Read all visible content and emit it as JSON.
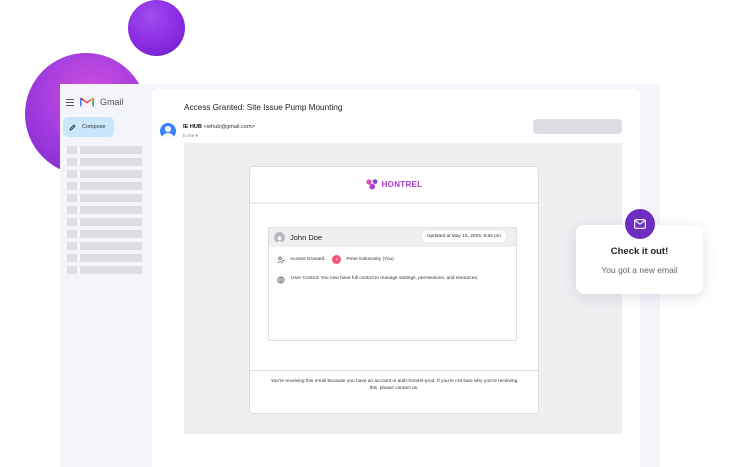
{
  "gmail": {
    "app_label": "Gmail",
    "compose_label": "Compose"
  },
  "email": {
    "subject": "Access Granted: Site Issue Pump Mounting",
    "sender_name": "IE HUB",
    "sender_email": "<iehub@gmail.com>",
    "to_line": "to me ▾"
  },
  "message": {
    "brand": "HONTREL",
    "user_name": "John Doe",
    "updated": "Updated at May 15, 2025, 6:55 pm",
    "access_label": "Access Granted:",
    "grantee_initial": "P",
    "grantee": "Peter Kalovnsky (You)",
    "control_text": "User Control: You now have full control to manage settings, permissions, and resources.",
    "footer": "You're receiving this email because you have an account in auth-hontrel-prod. If you're not sure why you're receiving this, please contact us."
  },
  "notification": {
    "title": "Check it out!",
    "subtitle": "You got a new email"
  },
  "colors": {
    "accent": "#6d2ec0",
    "brand": "#a53ad1",
    "compose_bg": "#c9e6fb",
    "grantee": "#f4547a"
  }
}
